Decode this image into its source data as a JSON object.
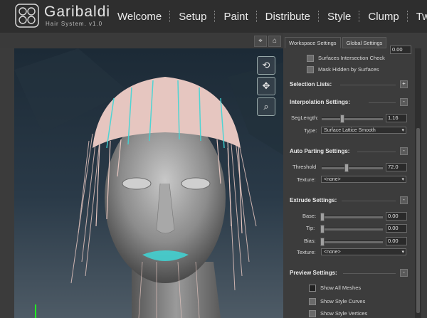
{
  "app": {
    "name": "Garibaldi",
    "subtitle": "Hair System.  v1.0"
  },
  "nav": {
    "items": [
      "Welcome",
      "Setup",
      "Paint",
      "Distribute",
      "Style",
      "Clump",
      "Tweak"
    ]
  },
  "viewport": {
    "toolbar_icons": [
      "crosshair-icon",
      "home-icon"
    ],
    "tools": [
      "rotate-icon",
      "pan-icon",
      "zoom-icon"
    ]
  },
  "panel": {
    "tabs": [
      "Workspace Settings",
      "Global Settings"
    ],
    "active_tab": "Workspace Settings",
    "top_field_value": "0.00",
    "checkboxes_top": [
      {
        "label": "Surfaces Intersection Check",
        "checked": false
      },
      {
        "label": "Mask Hidden by Surfaces",
        "checked": false
      }
    ],
    "selection_lists": {
      "title": "Selection Lists:",
      "toggle": "+"
    },
    "interpolation": {
      "title": "Interpolation Settings:",
      "toggle": "-",
      "seglength_label": "SegLength:",
      "seglength_value": "1.16",
      "seglength_level": 0.33,
      "type_label": "Type:",
      "type_value": "Surface Lattice Smooth"
    },
    "auto_parting": {
      "title": "Auto Parting Settings:",
      "toggle": "-",
      "threshold_label": "Threshold",
      "threshold_value": "72.0",
      "threshold_level": 0.4,
      "texture_label": "Texture:",
      "texture_value": "<none>"
    },
    "extrude": {
      "title": "Extrude Settings:",
      "toggle": "-",
      "base_label": "Base:",
      "base_value": "0.00",
      "tip_label": "Tip:",
      "tip_value": "0.00",
      "bias_label": "Bias:",
      "bias_value": "0.00",
      "texture_label": "Texture:",
      "texture_value": "<none>"
    },
    "preview": {
      "title": "Preview Settings:",
      "toggle": "-",
      "checkboxes": [
        {
          "label": "Show All Meshes",
          "checked": false
        },
        {
          "label": "Show Style Curves",
          "checked": false
        },
        {
          "label": "Show Style Vertices",
          "checked": false
        }
      ]
    }
  },
  "colors": {
    "accent_cyan": "#3fd6d6",
    "hair_pink": "#e6c6c0",
    "bg_dark": "#2e2e2e",
    "panel_bg": "#3c3c3c"
  }
}
